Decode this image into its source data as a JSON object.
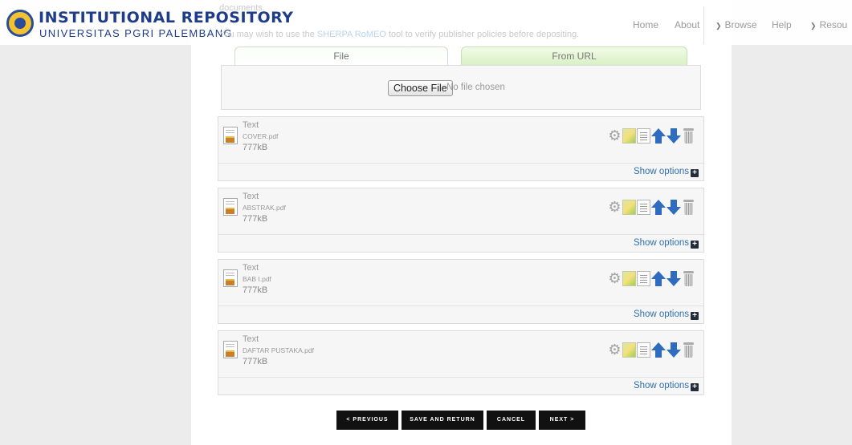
{
  "header": {
    "title": "INSTITUTIONAL REPOSITORY",
    "subtitle": "UNIVERSITAS PGRI PALEMBANG",
    "brand_color": "#1e3c89"
  },
  "intro": {
    "line1": "documents.",
    "line2_before": "You may wish to use the ",
    "line2_link": "SHERPA RoMEO",
    "line2_after": " tool to verify publisher policies before depositing."
  },
  "nav": {
    "home": "Home",
    "about": "About",
    "browse": "Browse",
    "help": "Help",
    "resources": "Resou"
  },
  "upload": {
    "tab_file": "File",
    "tab_url": "From URL",
    "choose_file": "Choose File",
    "no_file": "No file chosen"
  },
  "documents": [
    {
      "type": "Text",
      "filename": "COVER.pdf",
      "size": "777kB",
      "show_options": "Show options"
    },
    {
      "type": "Text",
      "filename": "ABSTRAK.pdf",
      "size": "777kB",
      "show_options": "Show options"
    },
    {
      "type": "Text",
      "filename": "BAB I.pdf",
      "size": "777kB",
      "show_options": "Show options"
    },
    {
      "type": "Text",
      "filename": "DAFTAR PUSTAKA.pdf",
      "size": "777kB",
      "show_options": "Show options"
    }
  ],
  "buttons": {
    "previous": "< PREVIOUS",
    "save_return": "SAVE AND RETURN",
    "cancel": "CANCEL",
    "next": "NEXT >"
  },
  "icons": [
    "gear-icon",
    "convert-icon",
    "preview-icon",
    "move-up-icon",
    "move-down-icon",
    "trash-icon",
    "plus-icon"
  ]
}
